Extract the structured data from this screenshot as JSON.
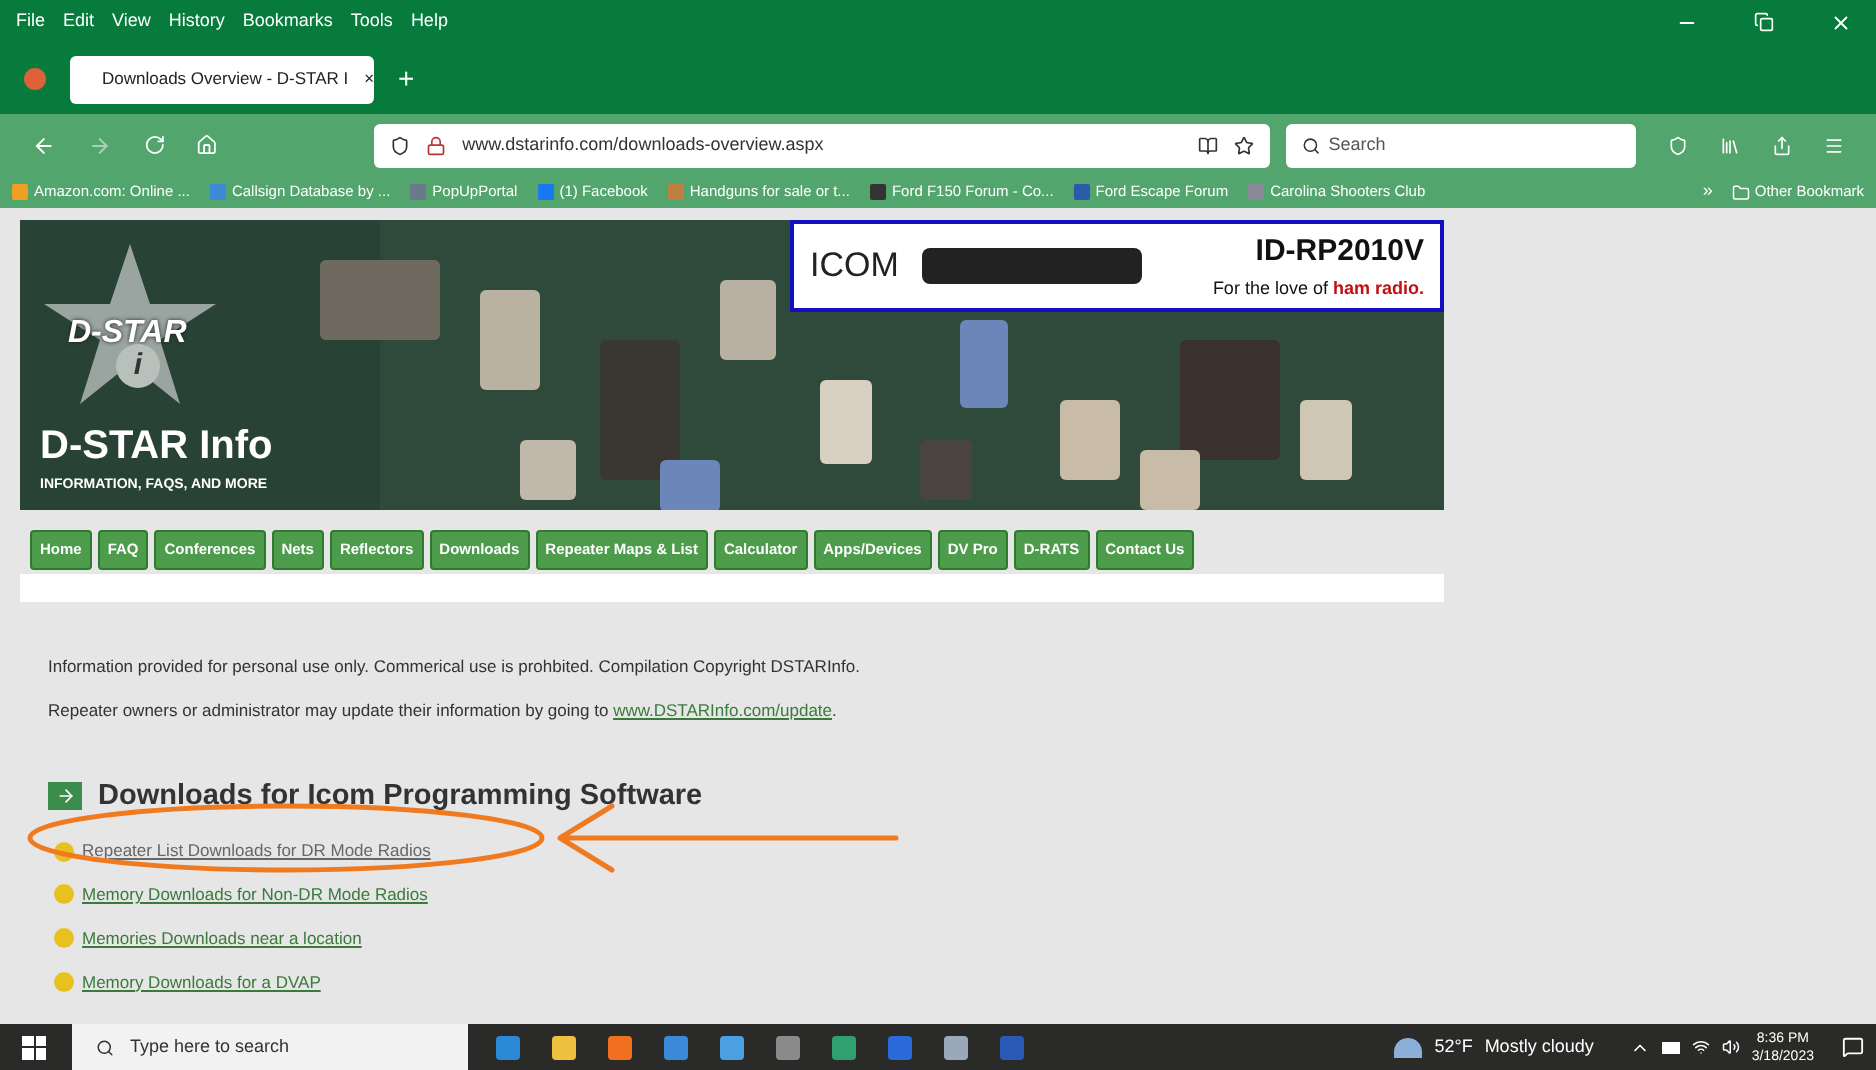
{
  "menu": [
    "File",
    "Edit",
    "View",
    "History",
    "Bookmarks",
    "Tools",
    "Help"
  ],
  "tab": {
    "title": "Downloads Overview - D-STAR I",
    "close": "×",
    "selected": true
  },
  "new_tab": "+",
  "url": "www.dstarinfo.com/downloads-overview.aspx",
  "search": {
    "placeholder": "Search"
  },
  "bookmarks": [
    {
      "label": "Amazon.com: Online ...",
      "color": "#f0a020"
    },
    {
      "label": "Callsign Database by ...",
      "color": "#3a8ad8"
    },
    {
      "label": "PopUpPortal",
      "color": "#6a7a8a"
    },
    {
      "label": "(1) Facebook",
      "color": "#1877f2"
    },
    {
      "label": "Handguns for sale or t...",
      "color": "#c08040"
    },
    {
      "label": "Ford F150 Forum - Co...",
      "color": "#333333"
    },
    {
      "label": "Ford Escape Forum",
      "color": "#2a5aa8"
    },
    {
      "label": "Carolina Shooters Club",
      "color": "#8a8a9a"
    }
  ],
  "bookmarks_more": "»",
  "other_bookmarks": "Other Bookmark",
  "banner": {
    "logo_star": "D-STAR",
    "logo_badge": "i",
    "title": "D-STAR Info",
    "subtitle": "INFORMATION, FAQS, AND MORE"
  },
  "ad": {
    "brand": "ICOM",
    "model": "ID-RP2010V",
    "slogan": "For the love of",
    "slogan_highlight": "ham radio."
  },
  "nav": [
    "Home",
    "FAQ",
    "Conferences",
    "Nets",
    "Reflectors",
    "Downloads",
    "Repeater Maps & List",
    "Calculator",
    "Apps/Devices",
    "DV Pro",
    "D-RATS",
    "Contact Us"
  ],
  "notice": "Information provided for personal use only. Commerical use is prohbited. Compilation Copyright DSTARInfo.",
  "update_line": {
    "text": "Repeater owners or administrator may update their information by going to",
    "link": "www.DSTARInfo.com/update",
    "end": "."
  },
  "heading": "Downloads for Icom Programming Software",
  "links": [
    {
      "label": "Repeater List Downloads for DR Mode Radios",
      "visited": true
    },
    {
      "label": "Memory Downloads for Non-DR Mode Radios",
      "visited": false
    },
    {
      "label": "Memories Downloads near a location",
      "visited": false
    },
    {
      "label": "Memory Downloads for a DVAP",
      "visited": false
    }
  ],
  "taskbar": {
    "search_placeholder": "Type here to search",
    "weather": "52°F",
    "weather_text": "Mostly cloudy",
    "time": "8:36 PM",
    "date": "3/18/2023"
  }
}
